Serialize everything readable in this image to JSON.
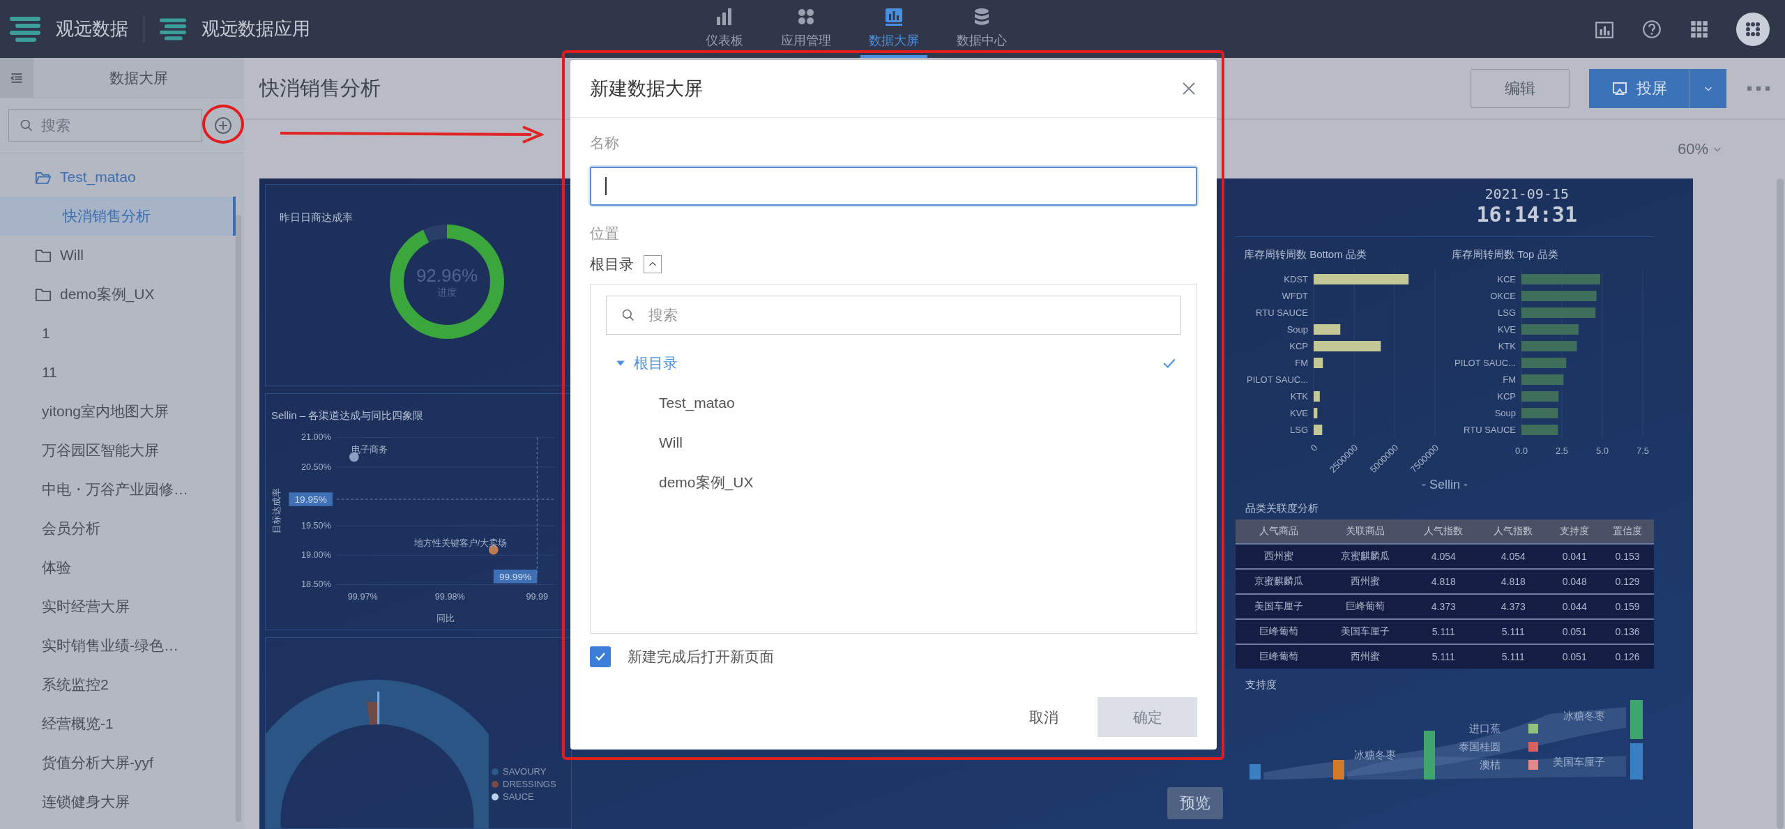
{
  "top_bar": {
    "brand": "观远数据",
    "app_name": "观远数据应用",
    "nav": [
      {
        "label": "仪表板",
        "selected": false
      },
      {
        "label": "应用管理",
        "selected": false
      },
      {
        "label": "数据大屏",
        "selected": true
      },
      {
        "label": "数据中心",
        "selected": false
      }
    ]
  },
  "sidebar": {
    "title": "数据大屏",
    "search": {
      "placeholder": "搜索"
    },
    "items": [
      {
        "label": "Test_matao",
        "kind": "folder",
        "expanded": true,
        "selected": false,
        "children": [
          {
            "label": "快消销售分析",
            "kind": "screen",
            "selected": true
          }
        ]
      },
      {
        "label": "Will",
        "kind": "folder",
        "expanded": false,
        "selected": false
      },
      {
        "label": "demo案例_UX",
        "kind": "folder",
        "expanded": false,
        "selected": false
      },
      {
        "label": "1",
        "kind": "screen",
        "selected": false
      },
      {
        "label": "11",
        "kind": "screen",
        "selected": false
      },
      {
        "label": "yitong室内地图大屏",
        "kind": "screen",
        "selected": false
      },
      {
        "label": "万谷园区智能大屏",
        "kind": "screen",
        "selected": false
      },
      {
        "label": "中电・万谷产业园修…",
        "kind": "screen",
        "selected": false
      },
      {
        "label": "会员分析",
        "kind": "screen",
        "selected": false
      },
      {
        "label": "体验",
        "kind": "screen",
        "selected": false
      },
      {
        "label": "实时经营大屏",
        "kind": "screen",
        "selected": false
      },
      {
        "label": "实时销售业绩-绿色…",
        "kind": "screen",
        "selected": false
      },
      {
        "label": "系统监控2",
        "kind": "screen",
        "selected": false
      },
      {
        "label": "经营概览-1",
        "kind": "screen",
        "selected": false
      },
      {
        "label": "货值分析大屏-yyf",
        "kind": "screen",
        "selected": false
      },
      {
        "label": "连锁健身大屏",
        "kind": "screen",
        "selected": false
      }
    ]
  },
  "page": {
    "title": "快消销售分析",
    "edit_button": "编辑",
    "cast_button": "投屏",
    "zoom": "60%"
  },
  "dashboard": {
    "gauge": {
      "title": "昨日日商达成率",
      "value": "92.96%",
      "caption": "进度",
      "level": 0.93
    },
    "scatter": {
      "title": "Sellin – 各渠道达成与同比四象限",
      "chart_data": {
        "type": "scatter",
        "xlabel": "同比",
        "ylabel": "目标达成率",
        "x": [
          99.969,
          99.985
        ],
        "grid": true,
        "series": [
          {
            "name": "电子商务",
            "color": "#8a9fc2",
            "values": [
              20.67,
              null
            ]
          },
          {
            "name": "地方性关键客户/大卖场",
            "color": "#c07a50",
            "values": [
              null,
              19.09
            ]
          }
        ],
        "xlim": [
          99.967,
          99.992
        ],
        "ylim": [
          18.5,
          21
        ],
        "xticks": [
          {
            "value": 99.97,
            "label": "99.97%"
          },
          {
            "value": 99.98,
            "label": "99.98%"
          },
          {
            "value": 99.99,
            "label": "99.99"
          }
        ],
        "yticks": [
          {
            "value": 21,
            "label": "21.00%"
          },
          {
            "value": 20.5,
            "label": "20.50%"
          },
          {
            "value": 19.5,
            "label": "19.50%"
          },
          {
            "value": 19,
            "label": "19.00%"
          },
          {
            "value": 18.5,
            "label": "18.50%"
          }
        ],
        "ref_lines": [
          {
            "axis": "y",
            "value": 19.95,
            "label": "19.95%"
          },
          {
            "axis": "x",
            "value": 99.99,
            "label": "99.99%"
          }
        ]
      }
    },
    "category_donut": {
      "legend": [
        {
          "label": "SAVOURY",
          "color": "#2b5a8c"
        },
        {
          "label": "DRESSINGS",
          "color": "#7a4a46"
        },
        {
          "label": "SAUCE",
          "color": "#b9d2ee"
        }
      ]
    },
    "preview_button": "预览",
    "date": "2021-09-15",
    "time": "16:14:31",
    "bar_charts": [
      {
        "title": "库存周转周数 Bottom 品类",
        "chart_data": {
          "type": "bar",
          "orientation": "horizontal",
          "categories": [
            "KDST",
            "WFDT",
            "RTU SAUCE",
            "Soup",
            "KCP",
            "FM",
            "PILOT SAUC...",
            "KTK",
            "KVE",
            "LSG"
          ],
          "grid": true,
          "series": [
            {
              "color": "#c3c896",
              "values": [
                5870000,
                0,
                0,
                1650000,
                4150000,
                570000,
                0,
                380000,
                230000,
                530000
              ]
            }
          ],
          "xlim": [
            0,
            7500000
          ],
          "xticks": [
            {
              "value": 0,
              "label": "0"
            },
            {
              "value": 2500000,
              "label": "2500000"
            },
            {
              "value": 5000000,
              "label": "5000000"
            },
            {
              "value": 7500000,
              "label": "7500000"
            }
          ]
        }
      },
      {
        "title": "库存周转周数 Top 品类",
        "chart_data": {
          "type": "bar",
          "orientation": "horizontal",
          "categories": [
            "KCE",
            "OKCE",
            "LSG",
            "KVE",
            "KTK",
            "PILOT SAUC...",
            "FM",
            "KCP",
            "Soup",
            "RTU SAUCE"
          ],
          "grid": true,
          "series": [
            {
              "color": "#3f6e5a",
              "values": [
                4.87,
                4.64,
                4.58,
                3.53,
                3.43,
                2.77,
                2.6,
                2.3,
                2.26,
                2.26
              ]
            }
          ],
          "xlim": [
            0,
            7.5
          ],
          "xticks": [
            {
              "value": 0,
              "label": "0.0"
            },
            {
              "value": 2.5,
              "label": "2.5"
            },
            {
              "value": 5,
              "label": "5.0"
            },
            {
              "value": 7.5,
              "label": "7.5"
            }
          ]
        }
      }
    ],
    "section_label": "- Sellin -",
    "table": {
      "title": "品类关联度分析",
      "columns": [
        "人气商品",
        "关联商品",
        "人气指数",
        "人气指数",
        "支持度",
        "置信度"
      ],
      "rows": [
        [
          "西州蜜",
          "京蜜麒麟瓜",
          "4.054",
          "4.054",
          "0.041",
          "0.153"
        ],
        [
          "京蜜麒麟瓜",
          "西州蜜",
          "4.818",
          "4.818",
          "0.048",
          "0.129"
        ],
        [
          "美国车厘子",
          "巨峰葡萄",
          "4.373",
          "4.373",
          "0.044",
          "0.159"
        ],
        [
          "巨峰葡萄",
          "美国车厘子",
          "5.111",
          "5.111",
          "0.051",
          "0.136"
        ],
        [
          "巨峰葡萄",
          "西州蜜",
          "5.111",
          "5.111",
          "0.051",
          "0.126"
        ]
      ]
    },
    "sankey": {
      "title": "支持度",
      "labels": [
        "冰糖冬枣",
        "进口蕉",
        "泰国桂圆",
        "澳桔",
        "冰糖冬枣",
        "美国车厘子"
      ]
    }
  },
  "modal": {
    "title": "新建数据大屏",
    "name_label": "名称",
    "name_focused": true,
    "location_label": "位置",
    "location": "根目录",
    "location_expanded": true,
    "tree": {
      "search_placeholder": "搜索",
      "root": {
        "label": "根目录",
        "expanded": true,
        "selected": true,
        "children": [
          {
            "label": "Test_matao",
            "selected": false
          },
          {
            "label": "Will",
            "selected": false
          },
          {
            "label": "demo案例_UX",
            "selected": false
          }
        ]
      }
    },
    "open_after_create": {
      "label": "新建完成后打开新页面",
      "checked": true
    },
    "buttons": [
      {
        "label": "取消",
        "kind": "text",
        "disabled": false
      },
      {
        "label": "确定",
        "kind": "primary",
        "disabled": true
      }
    ]
  }
}
